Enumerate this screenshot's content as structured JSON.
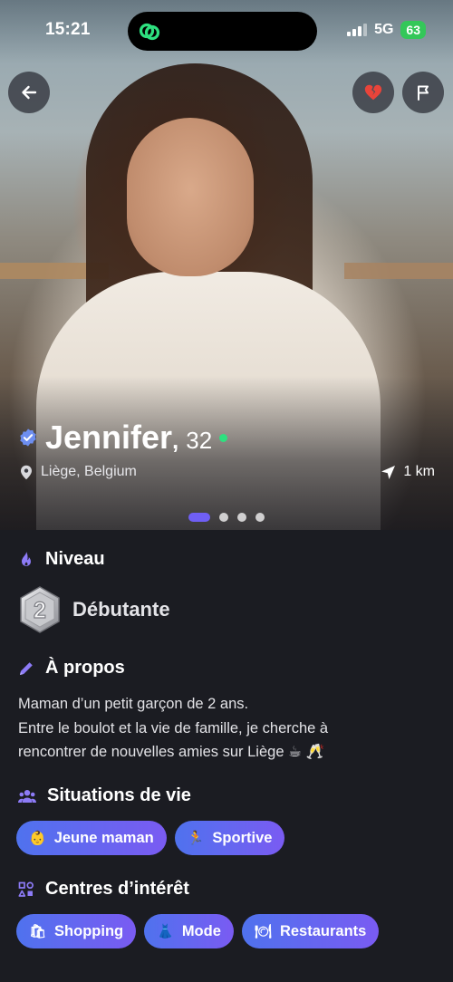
{
  "status_bar": {
    "time": "15:21",
    "network": "5G",
    "battery": "63"
  },
  "icons": {
    "back": "arrow-left-icon",
    "broken_heart": "broken-heart-icon",
    "report": "flag-icon",
    "verified": "verified-badge-icon",
    "online": "online-dot-icon",
    "location": "map-pin-icon",
    "distance": "navigation-arrow-icon",
    "level": "flame-icon",
    "about": "pencil-icon",
    "life": "people-icon",
    "interests": "shapes-icon"
  },
  "profile": {
    "name": "Jennifer",
    "age": "32",
    "location": "Liège, Belgium",
    "distance": "1 km",
    "photo_count": 4,
    "active_photo": 1
  },
  "level": {
    "title": "Niveau",
    "badge_number": "2",
    "label": "Débutante"
  },
  "about": {
    "title": "À propos",
    "lines": [
      "Maman d’un petit garçon de 2 ans.",
      "Entre le boulot et la vie de famille, je cherche à",
      "rencontrer de nouvelles amies sur Liège ☕ 🥂"
    ]
  },
  "life_situations": {
    "title": "Situations de vie",
    "chips": [
      {
        "emoji": "👶",
        "label": "Jeune maman"
      },
      {
        "emoji": "🏃",
        "label": "Sportive"
      }
    ]
  },
  "interests": {
    "title": "Centres d’intérêt",
    "chips": [
      {
        "emoji": "🛍",
        "label": "Shopping"
      },
      {
        "emoji": "👗",
        "label": "Mode"
      },
      {
        "emoji": "🍽",
        "label": "Restaurants"
      }
    ]
  },
  "colors": {
    "accent": "#6f5ff5",
    "online": "#2ee07f",
    "background": "#1b1c22",
    "broken_heart": "#e8443a"
  }
}
